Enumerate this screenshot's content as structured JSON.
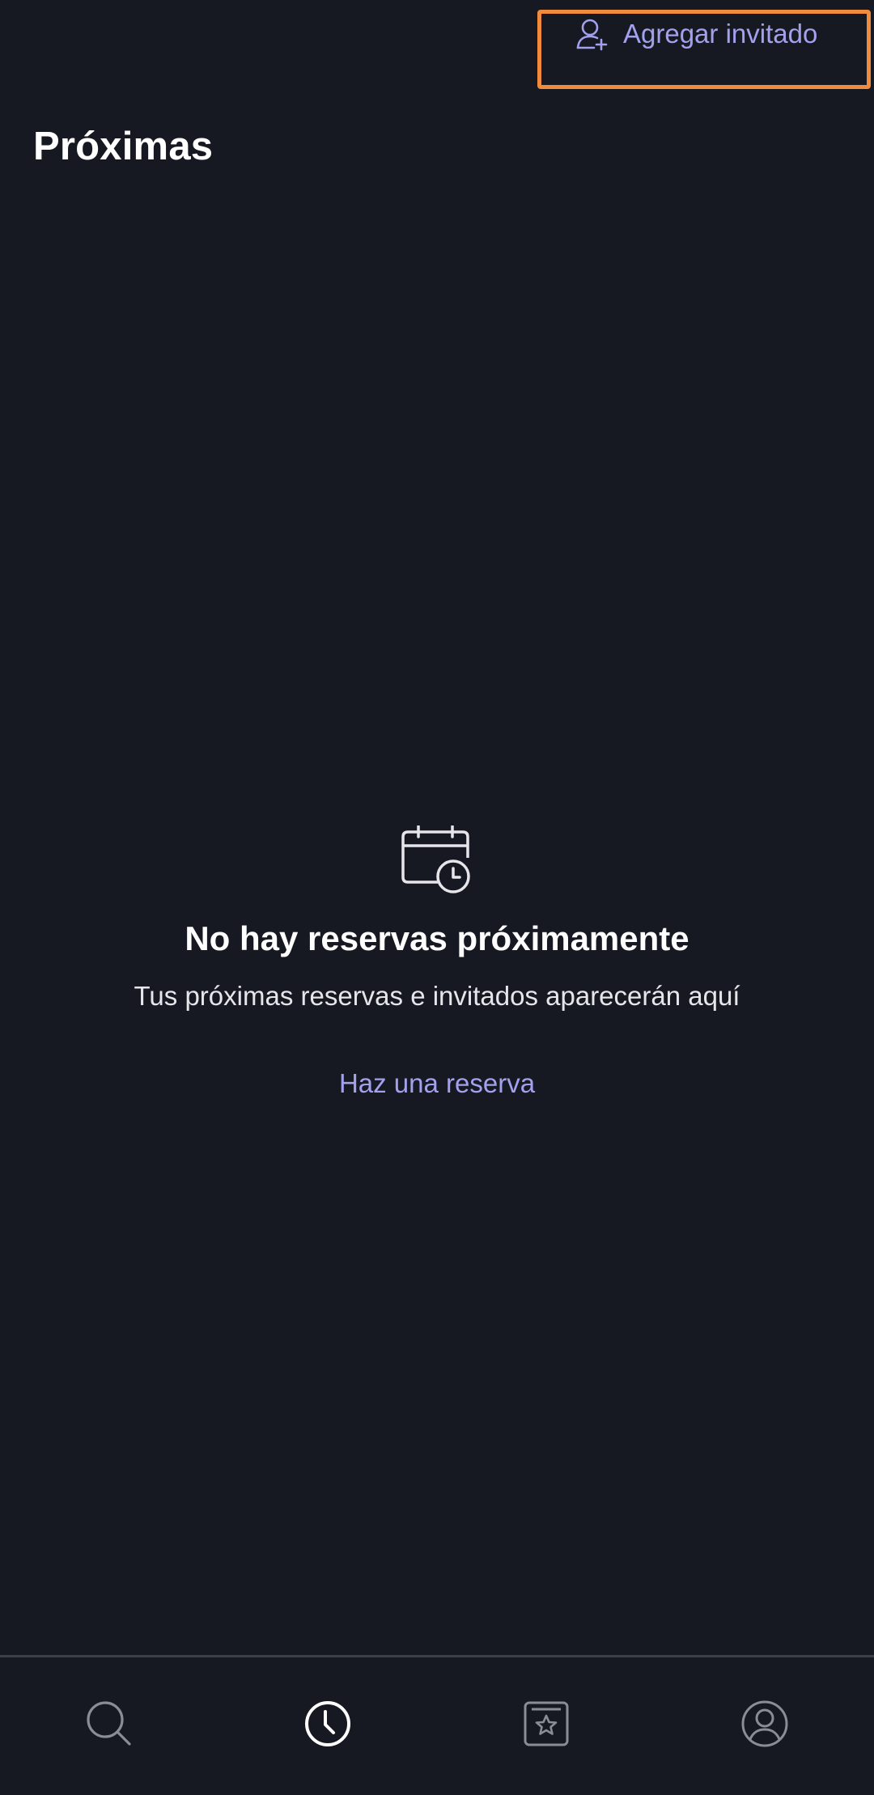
{
  "header": {
    "add_guest_label": "Agregar invitado",
    "add_guest_icon": "person-add-icon",
    "title": "Próximas"
  },
  "empty_state": {
    "icon": "calendar-clock-icon",
    "title": "No hay reservas próximamente",
    "subtitle": "Tus próximas reservas e invitados aparecerán aquí",
    "link_label": "Haz una reserva"
  },
  "bottom_nav": {
    "items": [
      {
        "icon": "search-icon",
        "active": false
      },
      {
        "icon": "clock-icon",
        "active": true
      },
      {
        "icon": "saved-star-icon",
        "active": false
      },
      {
        "icon": "profile-icon",
        "active": false
      }
    ]
  },
  "colors": {
    "background": "#161921",
    "accent": "#a3a1ee",
    "highlight_border": "#f08a3c",
    "nav_inactive": "#8a8d96",
    "nav_active": "#ffffff"
  }
}
